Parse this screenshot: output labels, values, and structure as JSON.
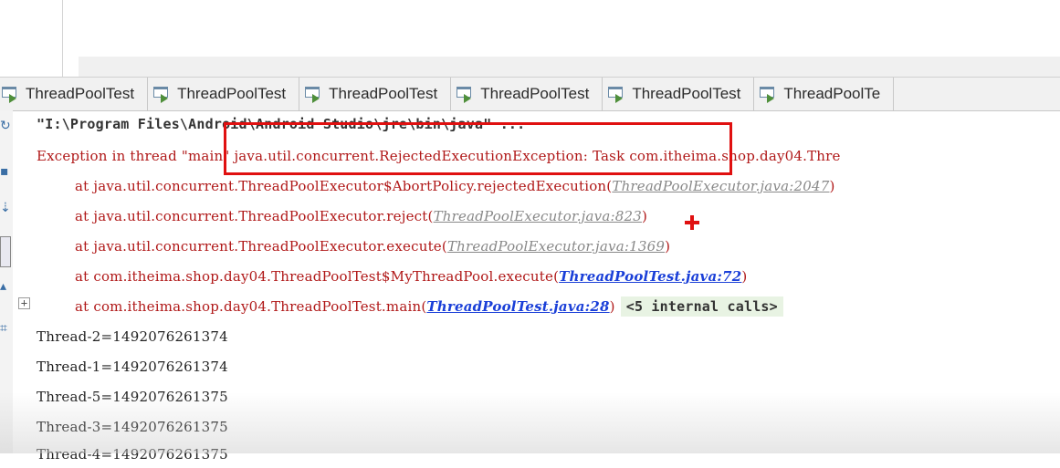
{
  "tabs": [
    {
      "label": "ThreadPoolTest"
    },
    {
      "label": "ThreadPoolTest"
    },
    {
      "label": "ThreadPoolTest"
    },
    {
      "label": "ThreadPoolTest"
    },
    {
      "label": "ThreadPoolTest"
    },
    {
      "label": "ThreadPoolTe"
    }
  ],
  "console": {
    "command": "\"I:\\Program Files\\Android\\Android Studio\\jre\\bin\\java\" ...",
    "exception": "Exception in thread \"main\" java.util.concurrent.RejectedExecutionException: Task com.itheima.shop.day04.Thre",
    "stack": [
      {
        "text": "at java.util.concurrent.ThreadPoolExecutor$AbortPolicy.rejectedExecution",
        "link": "ThreadPoolExecutor.java:2047",
        "project": false
      },
      {
        "text": "at java.util.concurrent.ThreadPoolExecutor.reject",
        "link": "ThreadPoolExecutor.java:823",
        "project": false
      },
      {
        "text": "at java.util.concurrent.ThreadPoolExecutor.execute",
        "link": "ThreadPoolExecutor.java:1369",
        "project": false
      },
      {
        "text": "at com.itheima.shop.day04.ThreadPoolTest$MyThreadPool.execute",
        "link": "ThreadPoolTest.java:72",
        "project": true
      },
      {
        "text": "at com.itheima.shop.day04.ThreadPoolTest.main",
        "link": "ThreadPoolTest.java:28",
        "project": true
      }
    ],
    "internal_calls": "<5 internal calls>",
    "output": [
      "Thread-2=1492076261374",
      "Thread-1=1492076261374",
      "Thread-5=1492076261375",
      "Thread-3=1492076261375",
      "Thread-4=1492076261375"
    ],
    "expand_symbol": "+"
  },
  "colors": {
    "error": "#b01818",
    "link_project": "#1a3fd8",
    "link_library": "#888888",
    "annotation": "#e01010"
  },
  "icons": {
    "tab_icon": "run-config-icon",
    "expand_icon": "plus-expand-icon"
  }
}
